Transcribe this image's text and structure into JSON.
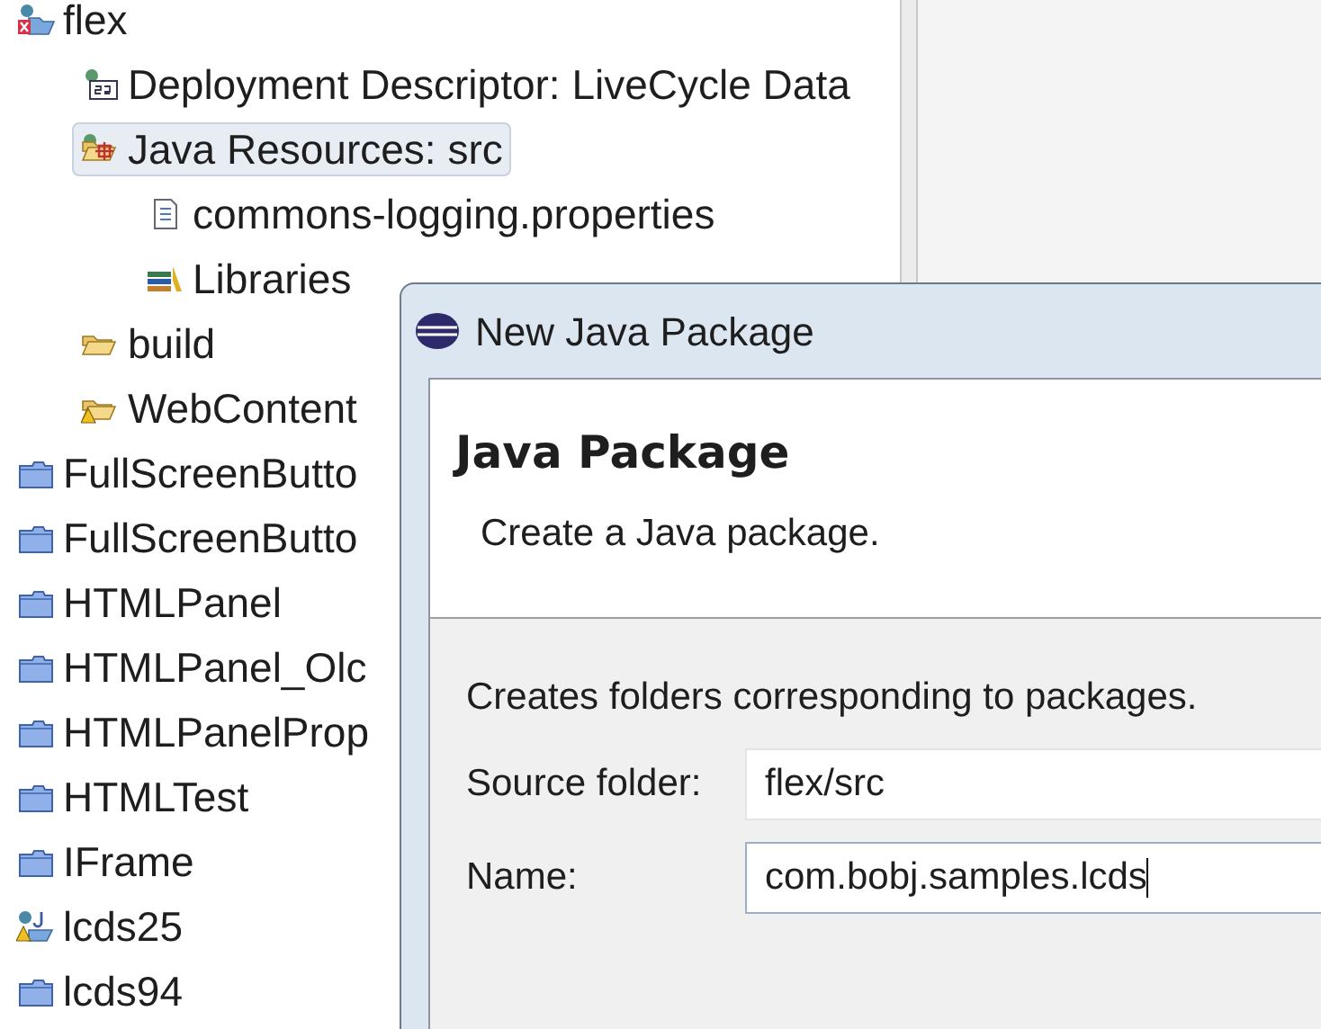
{
  "tree": [
    {
      "label": "flex",
      "kind": "project-error",
      "selected": false,
      "children": [
        {
          "label": "Deployment Descriptor: LiveCycle Data",
          "kind": "descriptor",
          "selected": false
        },
        {
          "label": "Java Resources: src",
          "kind": "java-resources",
          "selected": true,
          "children": [
            {
              "label": "commons-logging.properties",
              "kind": "file",
              "selected": false
            },
            {
              "label": "Libraries",
              "kind": "libraries",
              "selected": false
            }
          ]
        },
        {
          "label": "build",
          "kind": "open-folder",
          "selected": false
        },
        {
          "label": "WebContent",
          "kind": "open-folder-warning",
          "selected": false
        }
      ]
    },
    {
      "label": "FullScreenButto",
      "kind": "closed-project",
      "selected": false
    },
    {
      "label": "FullScreenButto",
      "kind": "closed-project",
      "selected": false
    },
    {
      "label": "HTMLPanel",
      "kind": "closed-project",
      "selected": false
    },
    {
      "label": "HTMLPanel_Olc",
      "kind": "closed-project",
      "selected": false
    },
    {
      "label": "HTMLPanelProp",
      "kind": "closed-project",
      "selected": false
    },
    {
      "label": "HTMLTest",
      "kind": "closed-project",
      "selected": false
    },
    {
      "label": "IFrame",
      "kind": "closed-project",
      "selected": false
    },
    {
      "label": "lcds25",
      "kind": "project-warning",
      "selected": false
    },
    {
      "label": "lcds94",
      "kind": "closed-project",
      "selected": false
    }
  ],
  "dialog": {
    "title": "New Java Package",
    "heading": "Java Package",
    "subtitle": "Create a Java package.",
    "description": "Creates folders corresponding to packages.",
    "fields": [
      {
        "label": "Source folder:",
        "value": "flex/src",
        "focused": false
      },
      {
        "label": "Name:",
        "value": "com.bobj.samples.lcds",
        "focused": true
      }
    ]
  }
}
